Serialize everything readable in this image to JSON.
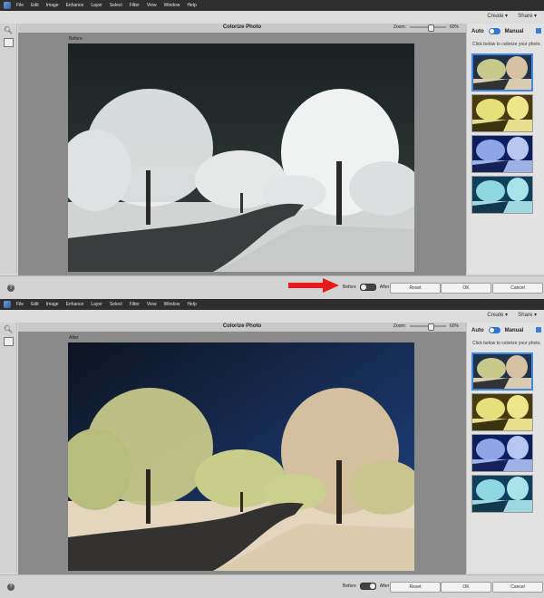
{
  "menu": [
    "File",
    "Edit",
    "Image",
    "Enhance",
    "Layer",
    "Select",
    "Filter",
    "View",
    "Window",
    "Help"
  ],
  "ribbon": {
    "create": "Create ▾",
    "share": "Share ▾"
  },
  "dialog": {
    "title": "Colorize Photo",
    "zoom_label": "Zoom:",
    "zoom_value": "60%",
    "zoom_fraction": 0.6,
    "mode_auto": "Auto",
    "mode_manual": "Manual",
    "hint": "Click below to colorize your photo.",
    "buttons": {
      "reset": "Reset",
      "ok": "OK",
      "cancel": "Cancel"
    },
    "before_label": "Before",
    "after_label": "After"
  },
  "panels": [
    {
      "view_label": "Before",
      "state": "before"
    },
    {
      "view_label": "After",
      "state": "after"
    }
  ],
  "colors": {
    "accent": "#2f76d0",
    "arrow": "#e81a1a",
    "bw_sky": "#1f2a2b",
    "color_sky": "#1e3d7a",
    "color_foliage": "#cfd39a"
  }
}
